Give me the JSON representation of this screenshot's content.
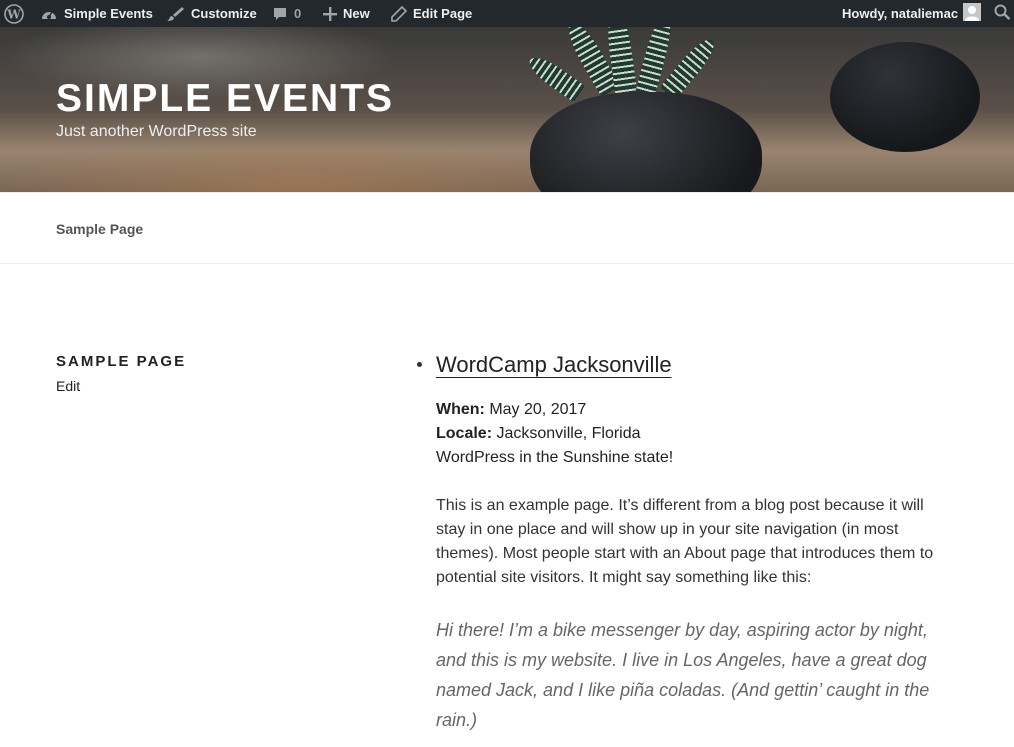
{
  "adminbar": {
    "site_name": "Simple Events",
    "customize": "Customize",
    "comments_count": "0",
    "new": "New",
    "edit_page": "Edit Page",
    "howdy": "Howdy, nataliemac"
  },
  "header": {
    "site_title": "Simple Events",
    "tagline": "Just another WordPress site"
  },
  "nav": {
    "items": [
      "Sample Page"
    ]
  },
  "sidebar": {
    "heading": "Sample Page",
    "edit": "Edit"
  },
  "event": {
    "title": "WordCamp Jacksonville",
    "when_label": "When:",
    "when_value": "May 20, 2017",
    "locale_label": "Locale:",
    "locale_value": "Jacksonville, Florida",
    "description": "WordPress in the Sunshine state!"
  },
  "content": {
    "paragraph": "This is an example page. It’s different from a blog post because it will stay in one place and will show up in your site navigation (in most themes). Most people start with an About page that introduces them to potential site visitors. It might say something like this:",
    "quote": "Hi there! I’m a bike messenger by day, aspiring actor by night, and this is my website. I live in Los Angeles, have a great dog named Jack, and I like piña coladas. (And gettin’ caught in the rain.)"
  },
  "icons": {
    "wp": "wordpress-logo-icon",
    "site": "dashboard-icon",
    "customize": "brush-icon",
    "comments": "comment-icon",
    "new": "plus-icon",
    "edit": "pencil-icon",
    "avatar": "avatar-icon",
    "search": "search-icon"
  }
}
